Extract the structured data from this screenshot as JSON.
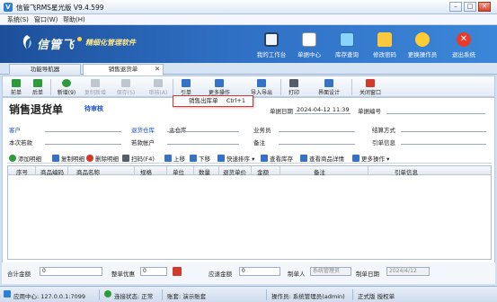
{
  "window": {
    "title": "信管飞RMS星光版 V9.4.599",
    "min": "–",
    "max": "□",
    "close": "✕"
  },
  "menu": [
    "系统(S)",
    "窗口(W)",
    "帮助(H)"
  ],
  "banner": {
    "brand": "信管飞",
    "slogan": "精细化管理软件",
    "buttons": [
      {
        "label": "我的工作台",
        "icon": "monitor-icon",
        "color": "#f5f5f5"
      },
      {
        "label": "单据中心",
        "icon": "document-icon",
        "color": "#ffffff"
      },
      {
        "label": "库存查询",
        "icon": "inventory-icon",
        "color": "#8ad3ff"
      },
      {
        "label": "修改密码",
        "icon": "lock-icon",
        "color": "#ffc83d"
      },
      {
        "label": "更换操作员",
        "icon": "user-icon",
        "color": "#ffcc33"
      },
      {
        "label": "退出系统",
        "icon": "exit-icon",
        "color": "#e83b2a"
      }
    ]
  },
  "tabs": [
    {
      "label": "功能导航器"
    },
    {
      "label": "销售退货单",
      "close": "✕"
    }
  ],
  "toolbar": [
    {
      "label": "前单",
      "icon": "prev-icon",
      "color": "#2e9b3a"
    },
    {
      "label": "后单",
      "icon": "next-icon",
      "color": "#2e9b3a"
    },
    {
      "label": "新增(9)",
      "icon": "add-icon",
      "color": "#2e9b3a"
    },
    {
      "label": "复制新增",
      "icon": "copy-add-icon",
      "color": "#9aa3ad"
    },
    {
      "label": "保存(S)",
      "icon": "save-icon",
      "color": "#9aa3ad"
    },
    {
      "label": "审核(A)",
      "icon": "approve-icon",
      "color": "#9aa3ad"
    },
    {
      "label": "引单",
      "icon": "import-doc-icon",
      "color": "#3572c8"
    },
    {
      "label": "更多操作",
      "icon": "more-ops-icon",
      "color": "#3572c8"
    },
    {
      "label": "导入导出",
      "icon": "import-export-icon",
      "color": "#3572c8"
    },
    {
      "label": "打印",
      "icon": "print-icon",
      "color": "#555e69"
    },
    {
      "label": "界面设计",
      "icon": "design-icon",
      "color": "#3572c8"
    },
    {
      "label": "关闭窗口",
      "icon": "close-window-icon",
      "color": "#d33a2a"
    }
  ],
  "dropdown": {
    "label": "销售出库单",
    "shortcut": "Ctrl+1"
  },
  "form": {
    "title": "销售退货单",
    "status": "待审核",
    "date_label": "单据日期",
    "date_value": "2024-04-12 11:39",
    "docno_label": "单据编号",
    "customer_label": "客户",
    "warehouse_label": "退货仓库",
    "warehouse_value": "主仓库",
    "salesman_label": "业务员",
    "settle_label": "结算方式",
    "balance_label": "本次若款",
    "account_label": "若款帐户",
    "remark_label": "备注",
    "ref_label": "引单信息"
  },
  "grid_toolbar": [
    {
      "label": "添加明细",
      "icon": "add-row-icon",
      "color": "#2e9b3a"
    },
    {
      "label": "复制明细",
      "icon": "copy-row-icon",
      "color": "#3572c8"
    },
    {
      "label": "删除明细",
      "icon": "delete-row-icon",
      "color": "#d33a2a"
    },
    {
      "label": "扫码(F4)",
      "icon": "scan-icon",
      "color": "#555e69"
    },
    {
      "label": "上移",
      "icon": "up-icon",
      "color": "#3572c8"
    },
    {
      "label": "下移",
      "icon": "down-icon",
      "color": "#3572c8"
    },
    {
      "label": "快速排序 ▾",
      "icon": "sort-icon",
      "color": "#3572c8"
    },
    {
      "label": "查看库存",
      "icon": "stock-icon",
      "color": "#3572c8"
    },
    {
      "label": "查看商品详情",
      "icon": "detail-icon",
      "color": "#3572c8"
    },
    {
      "label": "更多操作 ▾",
      "icon": "more-icon",
      "color": "#3572c8"
    }
  ],
  "grid_columns": [
    "序号",
    "商品编码",
    "商品名称",
    "规格",
    "单位",
    "数量",
    "退货单价",
    "金额",
    "备注",
    "引单信息"
  ],
  "footer": {
    "total_label": "合计金额",
    "total_value": "0",
    "discount_label": "整单优惠",
    "discount_value": "0",
    "payable_label": "应退金额",
    "payable_value": "0",
    "maker_label": "制单人",
    "maker_value": "系统管理员",
    "make_date_label": "制单日期",
    "make_date_value": "2024/4/12"
  },
  "statusbar": {
    "app_center": "应用中心: 127.0.0.1:7099",
    "link_status": "连接状态: 正常",
    "account": "账套: 演示账套",
    "operator": "操作员: 系统管理员(admin)",
    "edition": "正式版 授权单"
  }
}
